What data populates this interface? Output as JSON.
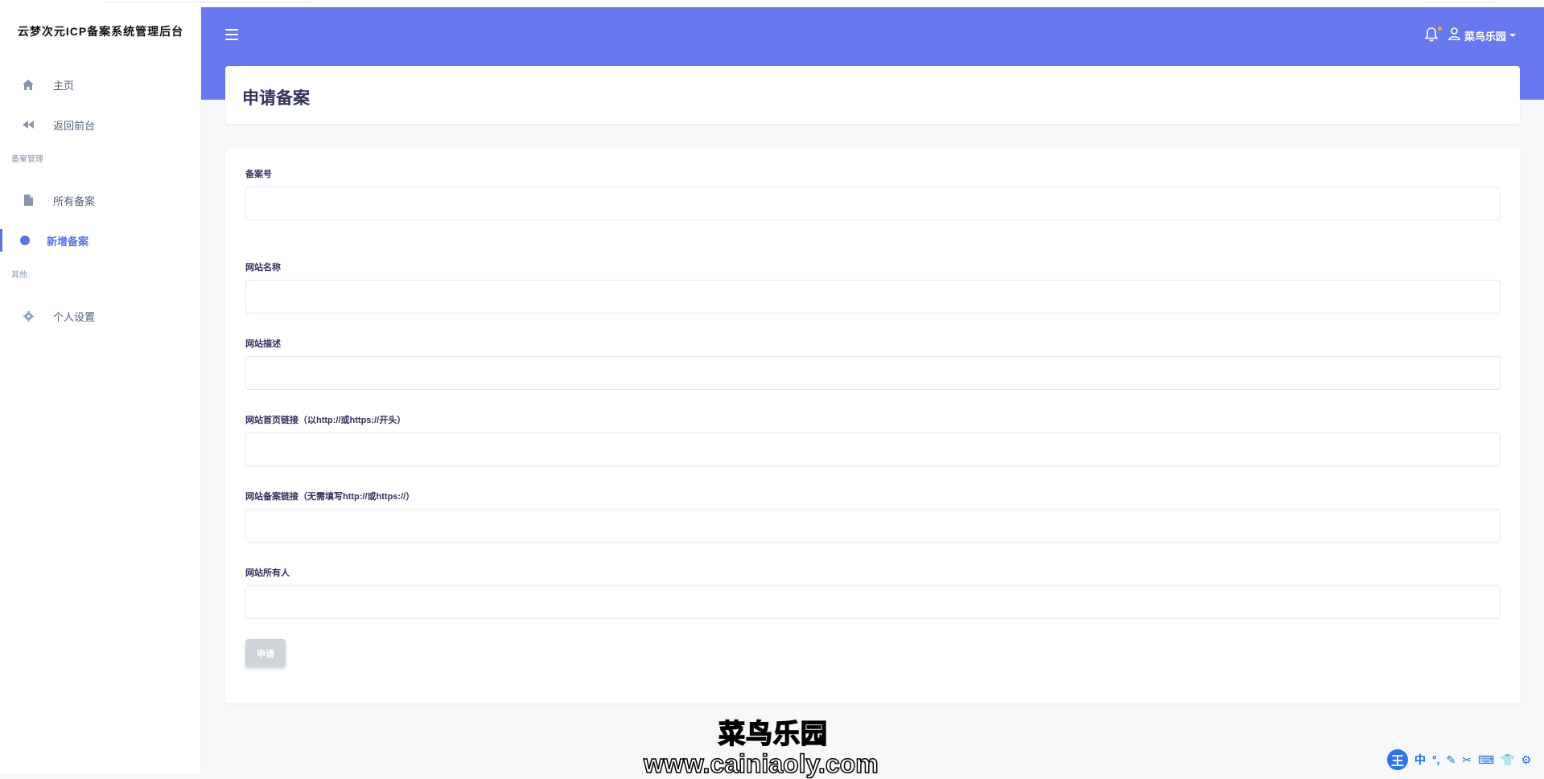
{
  "sidebar": {
    "brand": "云梦次元ICP备案系统管理后台",
    "items": [
      {
        "label": "主页",
        "icon": "home-icon"
      },
      {
        "label": "返回前台",
        "icon": "rewind-icon"
      },
      {
        "label": "所有备案",
        "icon": "file-icon"
      },
      {
        "label": "新增备案",
        "icon": "circle-icon",
        "active": true
      },
      {
        "label": "个人设置",
        "icon": "gear-icon"
      }
    ],
    "headings": [
      "备案管理",
      "其他"
    ]
  },
  "header": {
    "username": "菜鸟乐园",
    "accent_color": "#6878ee",
    "notification_dot_color": "#f5a623"
  },
  "page": {
    "title": "申请备案"
  },
  "form": {
    "fields": [
      {
        "label": "备案号",
        "value": ""
      },
      {
        "label": "网站名称",
        "value": ""
      },
      {
        "label": "网站描述",
        "value": ""
      },
      {
        "label": "网站首页链接（以http://或https://开头）",
        "value": ""
      },
      {
        "label": "网站备案链接（无需填写http://或https://）",
        "value": ""
      },
      {
        "label": "网站所有人",
        "value": ""
      }
    ],
    "submit_label": "申请"
  },
  "watermark": {
    "line1": "菜鸟乐园",
    "line2": "www.cainiaoly.com"
  },
  "ime": {
    "logo": "王",
    "items": [
      "中",
      "°,",
      "✎",
      "✂",
      "⌨",
      "👕",
      "⚙"
    ]
  }
}
